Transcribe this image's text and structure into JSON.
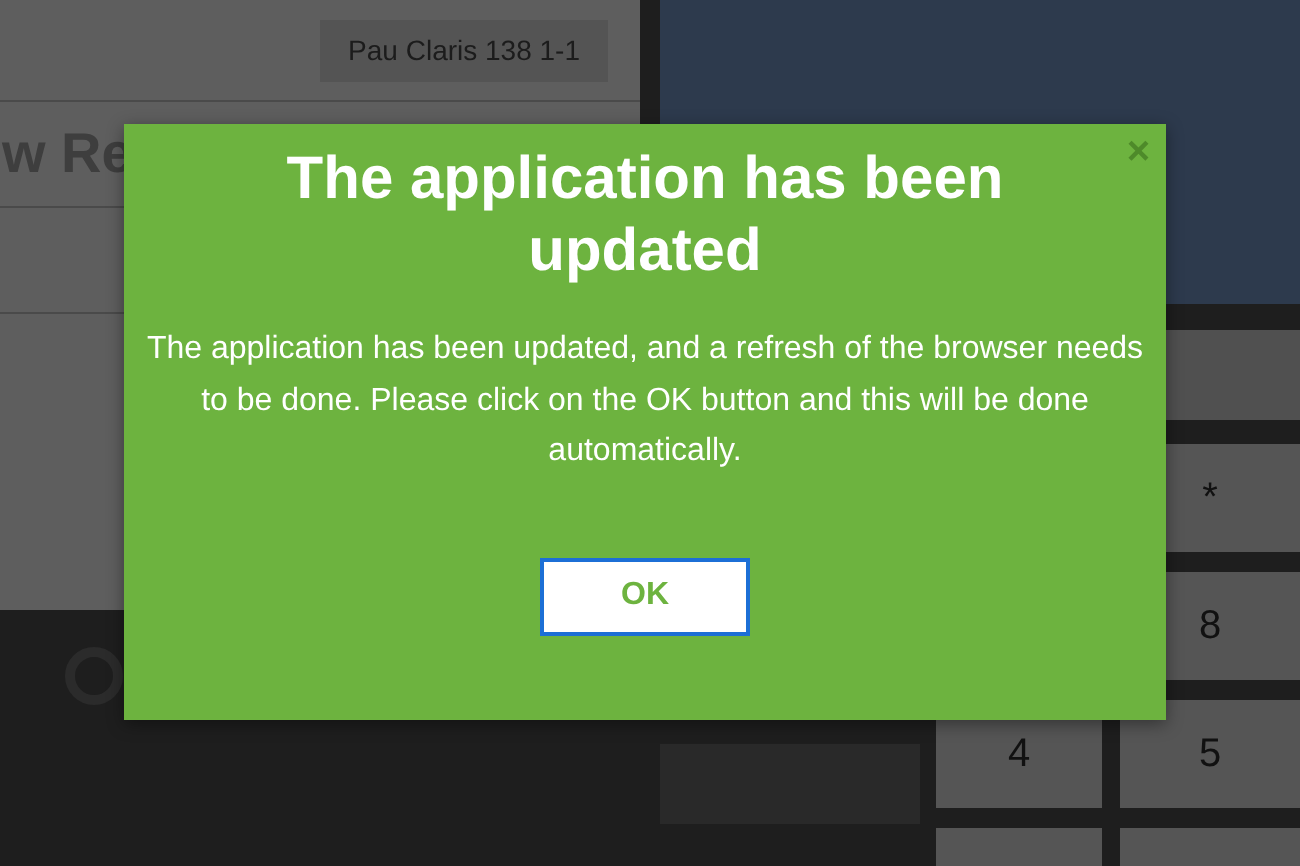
{
  "background": {
    "address": "Pau Claris 138 1-1",
    "heading": "w Re",
    "keypad": [
      "*",
      "8",
      "4",
      "5"
    ]
  },
  "dialog": {
    "title": "The application has been updated",
    "message": "The application has been updated, and a refresh of the browser needs to be done. Please click on the OK button and this will be done automatically.",
    "close": "×",
    "button": "OK"
  }
}
